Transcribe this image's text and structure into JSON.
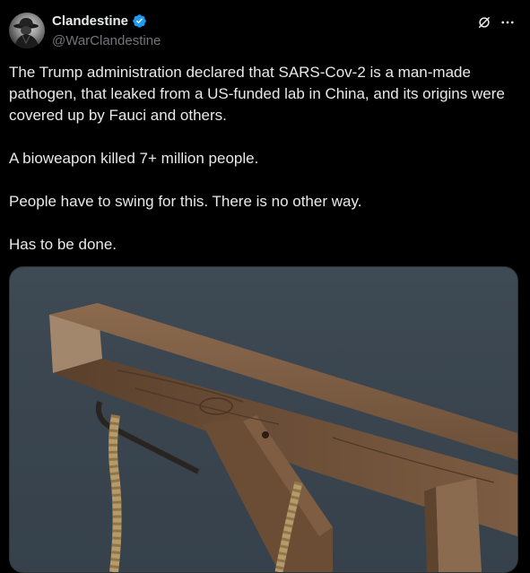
{
  "author": {
    "display_name": "Clandestine",
    "handle": "@WarClandestine",
    "avatar": "avatar-hat-figure",
    "verified_color": "#1d9bf0"
  },
  "actions": {
    "grok_icon": "grok-icon",
    "more_icon": "more-icon"
  },
  "tweet": {
    "paragraphs": [
      "The Trump administration declared that SARS-Cov-2 is a man-made pathogen, that leaked from a US-funded lab in China, and its origins were covered up by Fauci and others.",
      "A bioweapon killed 7+ million people.",
      "People have to swing for this. There is no other way.",
      "Has to be done."
    ]
  },
  "media": {
    "image": "wooden-gallows-with-noose-photo"
  },
  "colors": {
    "background": "#000000",
    "text": "#e7e9ea",
    "muted": "#71767b",
    "accent": "#1d9bf0"
  }
}
